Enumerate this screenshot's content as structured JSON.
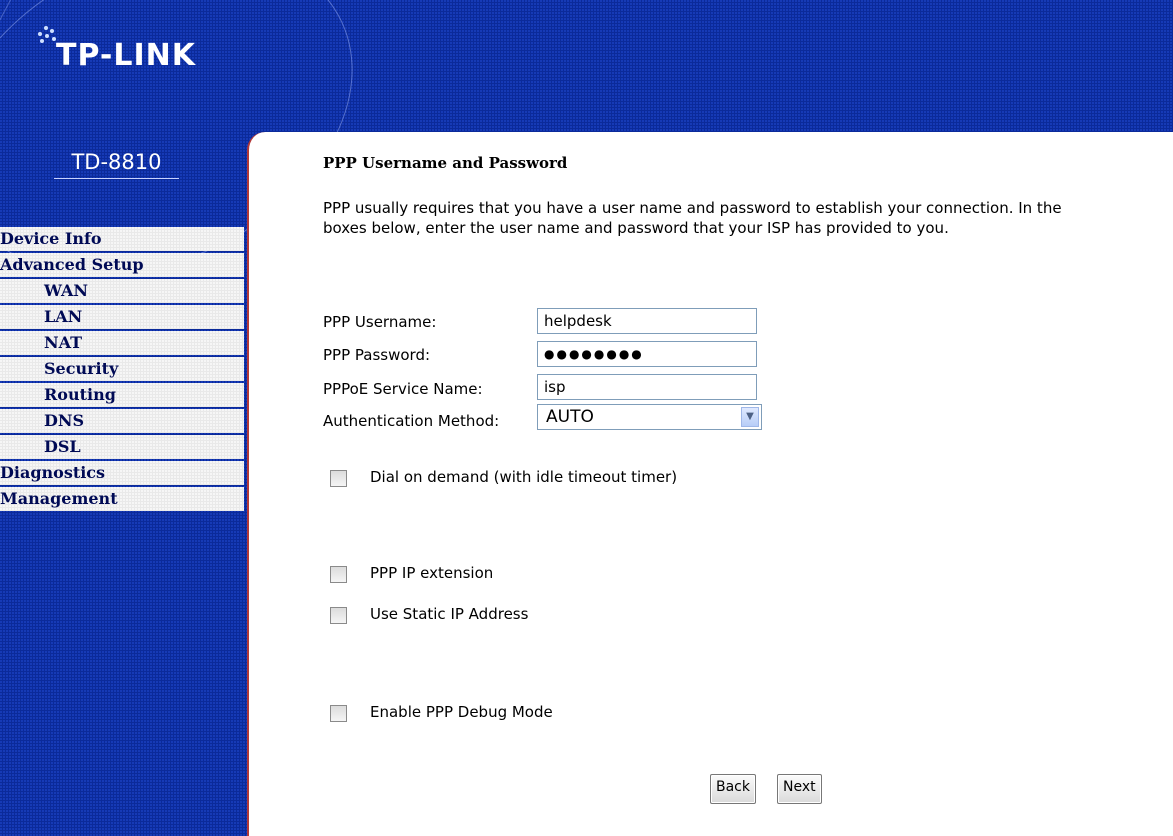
{
  "header": {
    "brand": "TP-LINK",
    "model": "TD-8810"
  },
  "sidebar": {
    "items": [
      {
        "label": "Device Info",
        "level": "top"
      },
      {
        "label": "Advanced Setup",
        "level": "top"
      },
      {
        "label": "WAN",
        "level": "sub"
      },
      {
        "label": "LAN",
        "level": "sub"
      },
      {
        "label": "NAT",
        "level": "sub"
      },
      {
        "label": "Security",
        "level": "sub"
      },
      {
        "label": "Routing",
        "level": "sub"
      },
      {
        "label": "DNS",
        "level": "sub"
      },
      {
        "label": "DSL",
        "level": "sub"
      },
      {
        "label": "Diagnostics",
        "level": "top"
      },
      {
        "label": "Management",
        "level": "top"
      }
    ]
  },
  "main": {
    "title": "PPP Username and Password",
    "description_line1": "PPP usually requires that you have a user name and password to establish your connection. In the",
    "description_line2": "boxes below, enter the user name and password that your ISP has provided to you.",
    "fields": {
      "username_label": "PPP Username:",
      "username_value": "helpdesk",
      "password_label": "PPP Password:",
      "password_value": "●●●●●●●●",
      "service_label": "PPPoE Service Name:",
      "service_value": "isp",
      "auth_label": "Authentication Method:",
      "auth_value": "AUTO"
    },
    "checkboxes": {
      "dial_on_demand": "Dial on demand (with idle timeout timer)",
      "ip_extension": "PPP IP extension",
      "static_ip": "Use Static IP Address",
      "debug_mode": "Enable PPP Debug Mode"
    },
    "buttons": {
      "back": "Back",
      "next": "Next"
    }
  },
  "colors": {
    "header_blue": "#0b2a9a",
    "nav_text": "#000a55",
    "content_border": "#b33838"
  }
}
